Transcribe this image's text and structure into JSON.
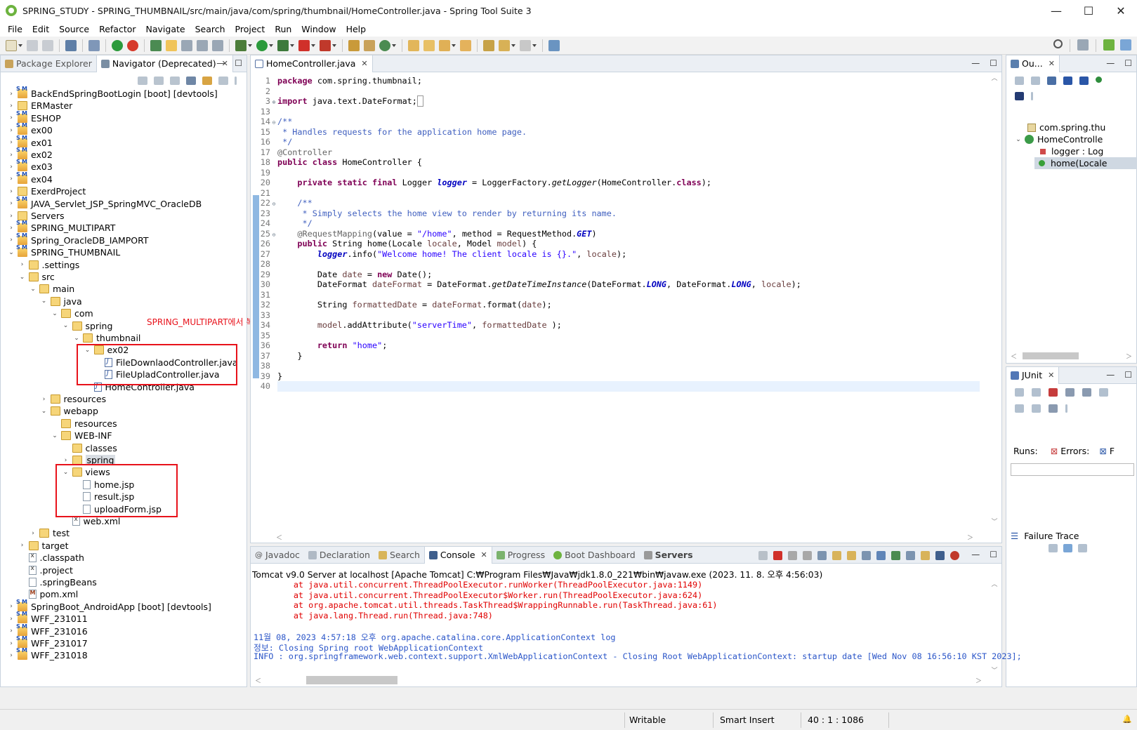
{
  "window": {
    "title": "SPRING_STUDY - SPRING_THUMBNAIL/src/main/java/com/spring/thumbnail/HomeController.java - Spring Tool Suite 3",
    "minimize": "—",
    "maximize": "☐",
    "close": "✕"
  },
  "menu": [
    "File",
    "Edit",
    "Source",
    "Refactor",
    "Navigate",
    "Search",
    "Project",
    "Run",
    "Window",
    "Help"
  ],
  "left_panel": {
    "tabs": [
      {
        "label": "Package Explorer"
      },
      {
        "label": "Navigator (Deprecated)"
      }
    ],
    "tree": [
      {
        "label": "BackEndSpringBootLogin [boot] [devtools]",
        "icon": "project",
        "depth": 0,
        "tw": "›"
      },
      {
        "label": "ERMaster",
        "icon": "folder",
        "depth": 0,
        "tw": "›"
      },
      {
        "label": "ESHOP",
        "icon": "project",
        "depth": 0,
        "tw": "›"
      },
      {
        "label": "ex00",
        "icon": "project",
        "depth": 0,
        "tw": "›"
      },
      {
        "label": "ex01",
        "icon": "project",
        "depth": 0,
        "tw": "›"
      },
      {
        "label": "ex02",
        "icon": "project",
        "depth": 0,
        "tw": "›"
      },
      {
        "label": "ex03",
        "icon": "project",
        "depth": 0,
        "tw": "›"
      },
      {
        "label": "ex04",
        "icon": "project",
        "depth": 0,
        "tw": "›"
      },
      {
        "label": "ExerdProject",
        "icon": "folder",
        "depth": 0,
        "tw": "›"
      },
      {
        "label": "JAVA_Servlet_JSP_SpringMVC_OracleDB",
        "icon": "project",
        "depth": 0,
        "tw": "›"
      },
      {
        "label": "Servers",
        "icon": "folder",
        "depth": 0,
        "tw": "›"
      },
      {
        "label": "SPRING_MULTIPART",
        "icon": "project",
        "depth": 0,
        "tw": "›"
      },
      {
        "label": "Spring_OracleDB_IAMPORT",
        "icon": "project",
        "depth": 0,
        "tw": "›"
      },
      {
        "label": "SPRING_THUMBNAIL",
        "icon": "project",
        "depth": 0,
        "tw": "⌄"
      },
      {
        "label": ".settings",
        "icon": "folder",
        "depth": 1,
        "tw": "›"
      },
      {
        "label": "src",
        "icon": "folder",
        "depth": 1,
        "tw": "⌄"
      },
      {
        "label": "main",
        "icon": "folder",
        "depth": 2,
        "tw": "⌄"
      },
      {
        "label": "java",
        "icon": "folder",
        "depth": 3,
        "tw": "⌄"
      },
      {
        "label": "com",
        "icon": "folder",
        "depth": 4,
        "tw": "⌄"
      },
      {
        "label": "spring",
        "icon": "folder",
        "depth": 5,
        "tw": "⌄"
      },
      {
        "label": "thumbnail",
        "icon": "folder",
        "depth": 6,
        "tw": "⌄"
      },
      {
        "label": "ex02",
        "icon": "folder",
        "depth": 7,
        "tw": "⌄"
      },
      {
        "label": "FileDownlaodController.java",
        "icon": "java",
        "depth": 8,
        "tw": ""
      },
      {
        "label": "FileUpladController.java",
        "icon": "java",
        "depth": 8,
        "tw": ""
      },
      {
        "label": "HomeController.java",
        "icon": "java",
        "depth": 7,
        "tw": ""
      },
      {
        "label": "resources",
        "icon": "folder",
        "depth": 3,
        "tw": "›"
      },
      {
        "label": "webapp",
        "icon": "folder",
        "depth": 3,
        "tw": "⌄"
      },
      {
        "label": "resources",
        "icon": "folder",
        "depth": 4,
        "tw": ""
      },
      {
        "label": "WEB-INF",
        "icon": "folder",
        "depth": 4,
        "tw": "⌄"
      },
      {
        "label": "classes",
        "icon": "folder",
        "depth": 5,
        "tw": ""
      },
      {
        "label": "spring",
        "icon": "folder",
        "depth": 5,
        "tw": "›",
        "hl": true
      },
      {
        "label": "views",
        "icon": "folder",
        "depth": 5,
        "tw": "⌄"
      },
      {
        "label": "home.jsp",
        "icon": "file",
        "depth": 6,
        "tw": ""
      },
      {
        "label": "result.jsp",
        "icon": "file",
        "depth": 6,
        "tw": ""
      },
      {
        "label": "uploadForm.jsp",
        "icon": "file",
        "depth": 6,
        "tw": ""
      },
      {
        "label": "web.xml",
        "icon": "xml",
        "depth": 5,
        "tw": ""
      },
      {
        "label": "test",
        "icon": "folder",
        "depth": 2,
        "tw": "›"
      },
      {
        "label": "target",
        "icon": "folder",
        "depth": 1,
        "tw": "›"
      },
      {
        "label": ".classpath",
        "icon": "xml",
        "depth": 1,
        "tw": ""
      },
      {
        "label": ".project",
        "icon": "xml",
        "depth": 1,
        "tw": ""
      },
      {
        "label": ".springBeans",
        "icon": "file",
        "depth": 1,
        "tw": ""
      },
      {
        "label": "pom.xml",
        "icon": "pom",
        "depth": 1,
        "tw": ""
      },
      {
        "label": "SpringBoot_AndroidApp [boot] [devtools]",
        "icon": "project",
        "depth": 0,
        "tw": "›"
      },
      {
        "label": "WFF_231011",
        "icon": "project",
        "depth": 0,
        "tw": "›"
      },
      {
        "label": "WFF_231016",
        "icon": "project",
        "depth": 0,
        "tw": "›"
      },
      {
        "label": "WFF_231017",
        "icon": "project",
        "depth": 0,
        "tw": "›"
      },
      {
        "label": "WFF_231018",
        "icon": "project",
        "depth": 0,
        "tw": "›"
      }
    ],
    "annotation": "SPRING_MULTIPART에서 복사해서 붙여넣기"
  },
  "editor": {
    "tab_label": "HomeController.java",
    "lines": [
      {
        "n": "1",
        "fold": "",
        "html": "<span class='kw'>package</span> com.spring.thumbnail;"
      },
      {
        "n": "2",
        "fold": "",
        "html": ""
      },
      {
        "n": "3",
        "fold": "⊕",
        "html": "<span class='kw'>import</span> java.text.DateFormat;<span style='border:1px solid #999;'>&nbsp;</span>"
      },
      {
        "n": "13",
        "fold": "",
        "html": ""
      },
      {
        "n": "14",
        "fold": "⊖",
        "html": "<span class='cm'>/**</span>"
      },
      {
        "n": "15",
        "fold": "",
        "html": "<span class='cm'> * Handles requests for the application home page.</span>"
      },
      {
        "n": "16",
        "fold": "",
        "html": "<span class='cm'> */</span>"
      },
      {
        "n": "17",
        "fold": "",
        "html": "<span class='ann'>@Controller</span>"
      },
      {
        "n": "18",
        "fold": "",
        "html": "<span class='kw'>public</span> <span class='kw'>class</span> HomeController {"
      },
      {
        "n": "19",
        "fold": "",
        "html": ""
      },
      {
        "n": "20",
        "fold": "",
        "html": "    <span class='kw'>private</span> <span class='kw'>static</span> <span class='kw'>final</span> Logger <span class='fld'>logger</span> = LoggerFactory.<span class='mth'>getLogger</span>(HomeController.<span class='kw'>class</span>);"
      },
      {
        "n": "21",
        "fold": "",
        "html": ""
      },
      {
        "n": "22",
        "fold": "⊖",
        "html": "    <span class='cm'>/**</span>"
      },
      {
        "n": "23",
        "fold": "",
        "html": "<span class='cm'>     * Simply selects the home view to render by returning its name.</span>"
      },
      {
        "n": "24",
        "fold": "",
        "html": "<span class='cm'>     */</span>"
      },
      {
        "n": "25",
        "fold": "⊖",
        "html": "    <span class='ann'>@RequestMapping</span>(value = <span class='str'>\"/home\"</span>, method = RequestMethod.<span class='sfld'>GET</span>)"
      },
      {
        "n": "26",
        "fold": "",
        "html": "    <span class='kw'>public</span> String home(Locale <span class='var'>locale</span>, Model <span class='var'>model</span>) {"
      },
      {
        "n": "27",
        "fold": "",
        "html": "        <span class='fld'>logger</span>.info(<span class='str'>\"Welcome home! The client locale is {}.\"</span>, <span class='var'>locale</span>);"
      },
      {
        "n": "28",
        "fold": "",
        "html": ""
      },
      {
        "n": "29",
        "fold": "",
        "html": "        Date <span class='var'>date</span> = <span class='kw'>new</span> Date();"
      },
      {
        "n": "30",
        "fold": "",
        "html": "        DateFormat <span class='var'>dateFormat</span> = DateFormat.<span class='mth'>getDateTimeInstance</span>(DateFormat.<span class='sfld'>LONG</span>, DateFormat.<span class='sfld'>LONG</span>, <span class='var'>locale</span>);"
      },
      {
        "n": "31",
        "fold": "",
        "html": ""
      },
      {
        "n": "32",
        "fold": "",
        "html": "        String <span class='var'>formattedDate</span> = <span class='var'>dateFormat</span>.format(<span class='var'>date</span>);"
      },
      {
        "n": "33",
        "fold": "",
        "html": ""
      },
      {
        "n": "34",
        "fold": "",
        "html": "        <span class='var'>model</span>.addAttribute(<span class='str'>\"serverTime\"</span>, <span class='var'>formattedDate</span> );"
      },
      {
        "n": "35",
        "fold": "",
        "html": ""
      },
      {
        "n": "36",
        "fold": "",
        "html": "        <span class='kw'>return</span> <span class='str'>\"home\"</span>;"
      },
      {
        "n": "37",
        "fold": "",
        "html": "    }"
      },
      {
        "n": "38",
        "fold": "",
        "html": ""
      },
      {
        "n": "39",
        "fold": "",
        "html": "}"
      },
      {
        "n": "40",
        "fold": "",
        "html": ""
      }
    ]
  },
  "outline": {
    "tab_label": "Ou...",
    "items": [
      {
        "label": "com.spring.thu",
        "icon": "package"
      },
      {
        "label": "HomeControlle",
        "icon": "class"
      },
      {
        "label": "logger : Log",
        "icon": "field"
      },
      {
        "label": "home(Locale",
        "icon": "method"
      }
    ]
  },
  "junit": {
    "tab_label": "JUnit",
    "runs_label": "Runs:",
    "errors_label": "Errors:",
    "failures_label": "F",
    "failure_trace": "Failure Trace"
  },
  "console": {
    "tabs": [
      "Javadoc",
      "Declaration",
      "Search",
      "Console",
      "Progress",
      "Boot Dashboard",
      "Servers"
    ],
    "header": "Tomcat v9.0 Server at localhost [Apache Tomcat] C:₩Program Files₩Java₩jdk1.8.0_221₩bin₩javaw.exe  (2023. 11. 8. 오후 4:56:03)",
    "lines": [
      {
        "text": "        at java.util.concurrent.ThreadPoolExecutor.runWorker(ThreadPoolExecutor.java:1149)",
        "type": "err"
      },
      {
        "text": "        at java.util.concurrent.ThreadPoolExecutor$Worker.run(ThreadPoolExecutor.java:624)",
        "type": "err"
      },
      {
        "text": "        at org.apache.tomcat.util.threads.TaskThread$WrappingRunnable.run(TaskThread.java:61)",
        "type": "err"
      },
      {
        "text": "        at java.lang.Thread.run(Thread.java:748)",
        "type": "err"
      },
      {
        "text": "",
        "type": "info"
      },
      {
        "text": "11월 08, 2023 4:57:18 오후 org.apache.catalina.core.ApplicationContext log",
        "type": "info"
      },
      {
        "text": "정보: Closing Spring root WebApplicationContext",
        "type": "info"
      },
      {
        "text": "INFO : org.springframework.web.context.support.XmlWebApplicationContext - Closing Root WebApplicationContext: startup date [Wed Nov 08 16:56:10 KST 2023];",
        "type": "info"
      }
    ]
  },
  "status": {
    "writable": "Writable",
    "insert_mode": "Smart Insert",
    "position": "40 : 1 : 1086"
  }
}
